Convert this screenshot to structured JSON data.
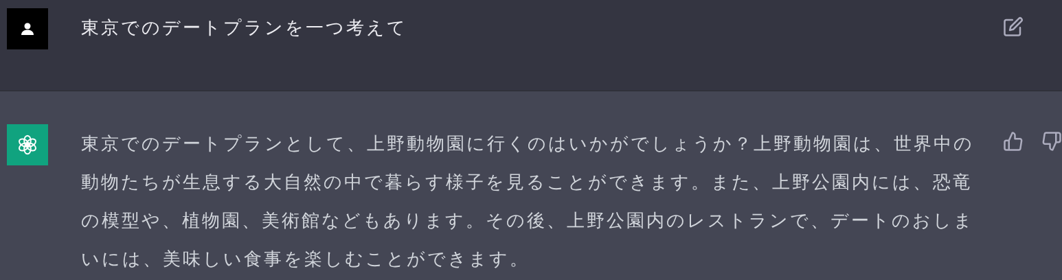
{
  "messages": [
    {
      "kind": "user",
      "text": "東京でのデートプランを一つ考えて"
    },
    {
      "kind": "assistant",
      "text": "東京でのデートプランとして、上野動物園に行くのはいかがでしょうか？上野動物園は、世界中の動物たちが生息する大自然の中で暮らす様子を見ることができます。また、上野公園内には、恐竜の模型や、植物園、美術館などもあります。その後、上野公園内のレストランで、デートのおしまいには、美味しい食事を楽しむことができます。"
    }
  ]
}
